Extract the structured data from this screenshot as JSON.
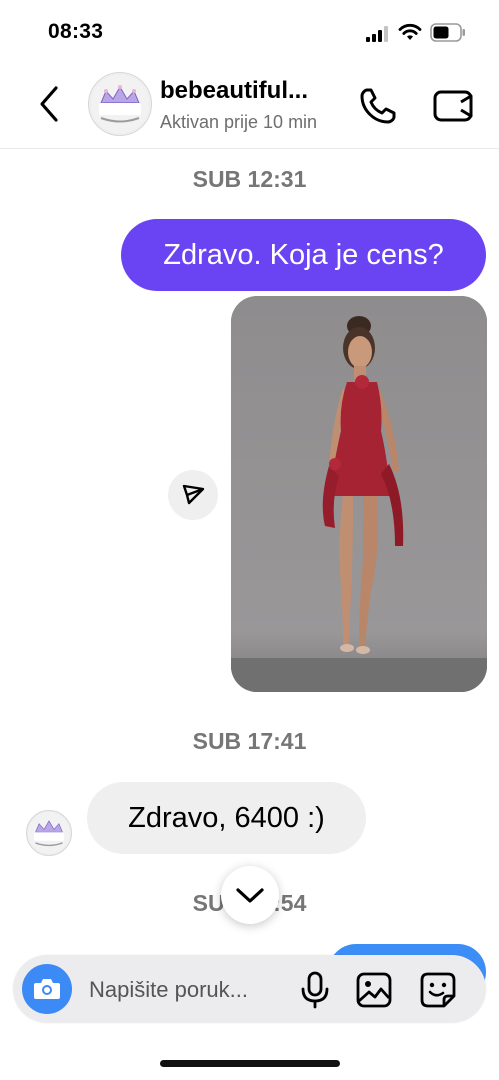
{
  "status_bar": {
    "time": "08:33"
  },
  "header": {
    "title": "bebeautiful...",
    "subtitle": "Aktivan prije 10 min",
    "avatar_logo_text": "BeBeautiful"
  },
  "messages": {
    "timestamp_1": "SUB 12:31",
    "outgoing_text": "Zdravo. Koja je cens?",
    "timestamp_2": "SUB 17:41",
    "incoming_text": "Zdravo, 6400 :)",
    "timestamp_3": "SUB 17:54"
  },
  "composer": {
    "placeholder": "Napišite poruk..."
  },
  "colors": {
    "outgoing_bubble": "#6a44f3",
    "incoming_bubble": "#efefef",
    "camera_button": "#3c8af5",
    "timestamp": "#767676"
  },
  "icons": [
    "back-chevron-icon",
    "phone-icon",
    "video-camera-icon",
    "share-send-icon",
    "chevron-down-icon",
    "camera-icon",
    "microphone-icon",
    "gallery-icon",
    "sticker-icon"
  ]
}
